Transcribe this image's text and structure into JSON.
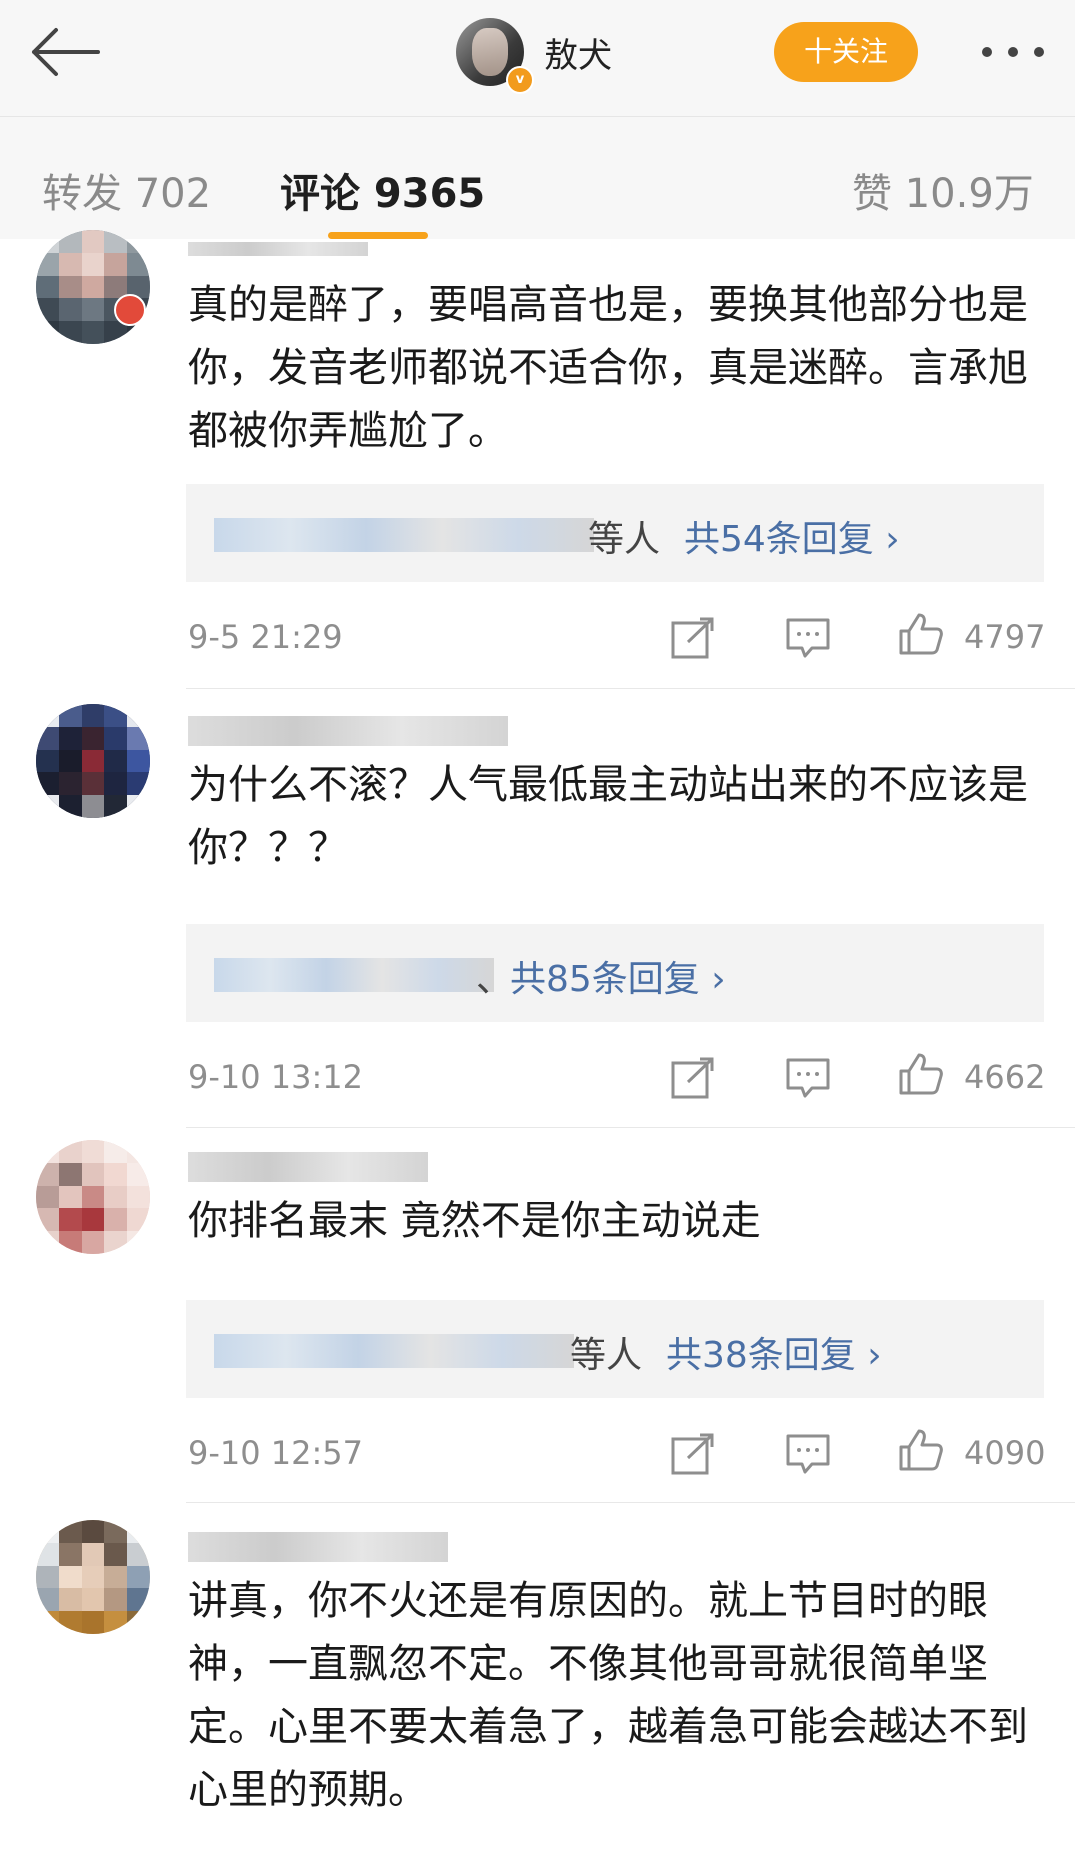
{
  "header": {
    "title": "敖犬",
    "follow_label": "十关注",
    "verified_badge": "v"
  },
  "tabs": [
    {
      "label": "转发 702"
    },
    {
      "label": "评论 9365"
    },
    {
      "label": "赞 10.9万"
    }
  ],
  "comments": [
    {
      "text": "真的是醉了，要唱高音也是，要换其他部分也是你，发音老师都说不适合你，真是迷醉。言承旭都被你弄尴尬了。",
      "reply_suffix": "等人",
      "reply_link": "共54条回复 ›",
      "time": "9-5 21:29",
      "likes": "4797"
    },
    {
      "text": "为什么不滚？人气最低最主动站出来的不应该是你？？？",
      "reply_suffix": "、",
      "reply_link": "共85条回复 ›",
      "time": "9-10 13:12",
      "likes": "4662"
    },
    {
      "text": "你排名最末 竟然不是你主动说走",
      "reply_suffix": "等人",
      "reply_link": "共38条回复 ›",
      "time": "9-10 12:57",
      "likes": "4090"
    },
    {
      "text": "讲真，你不火还是有原因的。就上节目时的眼神，一直飘忽不定。不像其他哥哥就很简单坚定。心里不要太着急了，越着急可能会越达不到心里的预期。"
    }
  ],
  "colors": {
    "accent": "#f7a21b",
    "link": "#4a6fa5",
    "muted": "#8e8e8e"
  },
  "icons": [
    "back-arrow-icon",
    "more-icon",
    "repost-icon",
    "comment-icon",
    "like-icon"
  ]
}
